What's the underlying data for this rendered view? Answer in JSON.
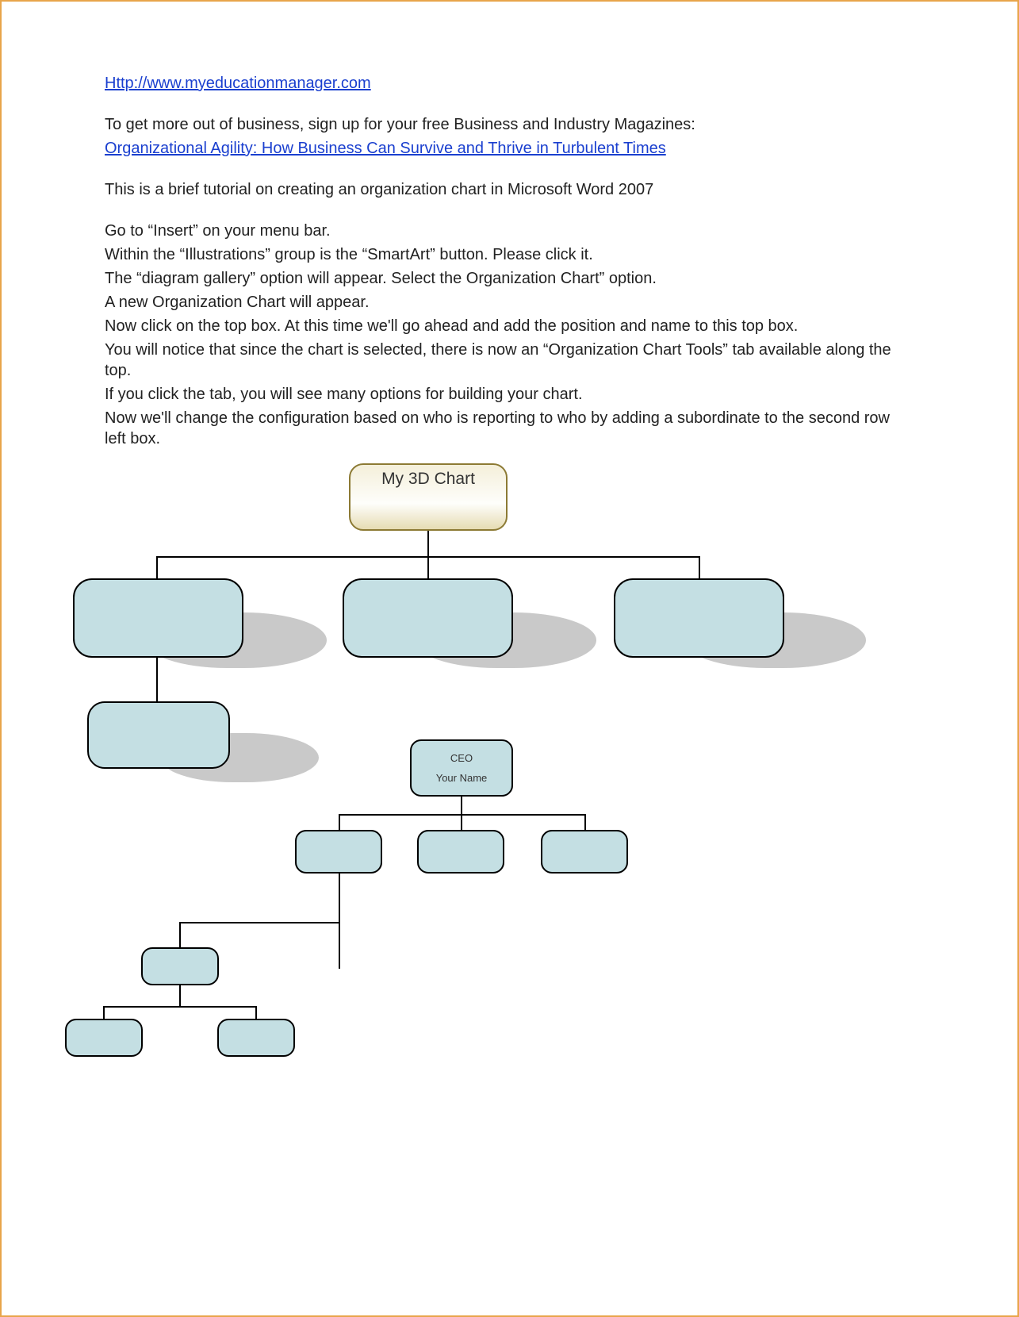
{
  "header_url": "Http://www.myeducationmanager.com",
  "promo_line": "To get more out of business, sign up for your free Business and Industry Magazines:",
  "promo_link": "Organizational Agility: How Business Can Survive and Thrive in Turbulent Times",
  "intro": "This is a brief tutorial on creating an organization chart in Microsoft Word 2007",
  "steps": [
    "Go to “Insert” on your menu bar.",
    "Within the “Illustrations” group is the “SmartArt” button. Please click it.",
    "The “diagram gallery” option will appear. Select the Organization Chart” option.",
    "A new Organization Chart will appear.",
    "Now click on the top box. At this time we'll go ahead and add the position and name to this top box.",
    "You will notice that since the chart is selected, there is now an “Organization Chart Tools” tab available along the top.",
    "If you click the tab, you will see many options for building your chart.",
    "Now we'll change the configuration based on who is reporting to who by adding a subordinate to the second row left box."
  ],
  "chart1": {
    "root_label": "My 3D Chart"
  },
  "chart2": {
    "root_title": "CEO",
    "root_name": "Your Name"
  }
}
